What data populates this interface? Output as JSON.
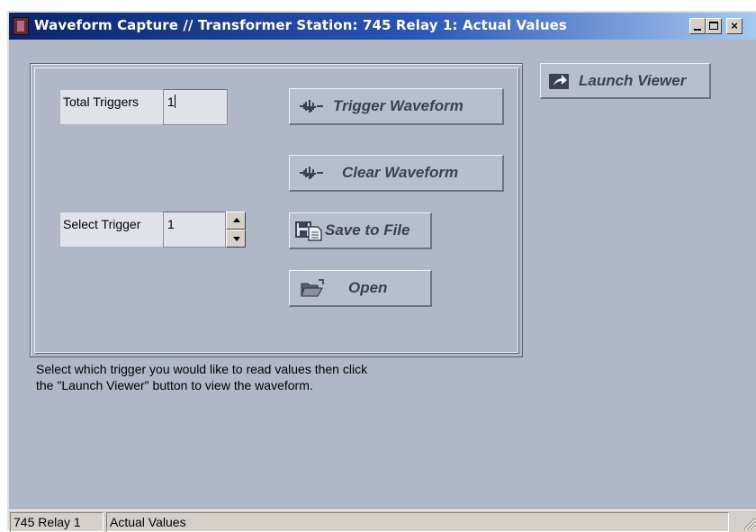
{
  "window": {
    "title": "Waveform Capture // Transformer Station: 745 Relay 1: Actual Values",
    "controls": {
      "minimize_icon": "minimize-icon",
      "maximize_icon": "maximize-icon",
      "close_label": "×"
    }
  },
  "fields": {
    "total_triggers": {
      "label": "Total Triggers",
      "value": "1"
    },
    "select_trigger": {
      "label": "Select Trigger",
      "value": "1"
    }
  },
  "buttons": {
    "trigger_waveform": {
      "label": "Trigger Waveform",
      "icon": "waveform-icon"
    },
    "clear_waveform": {
      "label": "Clear Waveform",
      "icon": "waveform-icon"
    },
    "save_to_file": {
      "label": "Save to File",
      "icon": "save-file-icon"
    },
    "open": {
      "label": "Open",
      "icon": "folder-open-icon"
    },
    "launch_viewer": {
      "label": "Launch Viewer",
      "icon": "launch-arrow-icon"
    }
  },
  "help_text": "Select which trigger you would like to read values then click the \"Launch Viewer\" button to view the waveform.",
  "statusbar": {
    "device": "745 Relay 1",
    "view": "Actual Values"
  },
  "colors": {
    "background": "#b0b7c6",
    "titlebar_start": "#0a246a",
    "titlebar_end": "#a6caf0",
    "button_text": "#3b4150"
  }
}
